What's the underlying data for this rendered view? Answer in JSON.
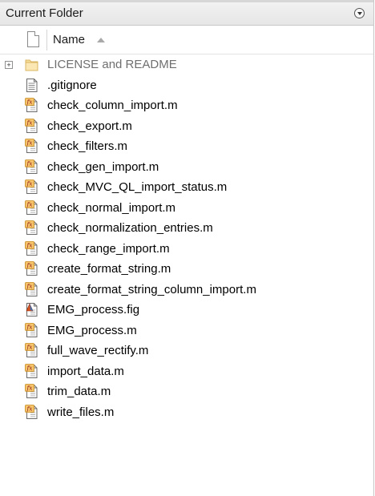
{
  "panel": {
    "title": "Current Folder",
    "menu_icon": "circle-chevron-down-icon",
    "column_header": "Name",
    "sort_indicator": "sort-ascending-icon"
  },
  "files": [
    {
      "name": "LICENSE and README",
      "type": "folder",
      "icon": "folder-icon"
    },
    {
      "name": ".gitignore",
      "type": "text",
      "icon": "text-file-icon"
    },
    {
      "name": "check_column_import.m",
      "type": "function",
      "icon": "matlab-function-icon"
    },
    {
      "name": "check_export.m",
      "type": "function",
      "icon": "matlab-function-icon"
    },
    {
      "name": "check_filters.m",
      "type": "function",
      "icon": "matlab-function-icon"
    },
    {
      "name": "check_gen_import.m",
      "type": "function",
      "icon": "matlab-function-icon"
    },
    {
      "name": "check_MVC_QL_import_status.m",
      "type": "function",
      "icon": "matlab-function-icon"
    },
    {
      "name": "check_normal_import.m",
      "type": "function",
      "icon": "matlab-function-icon"
    },
    {
      "name": "check_normalization_entries.m",
      "type": "function",
      "icon": "matlab-function-icon"
    },
    {
      "name": "check_range_import.m",
      "type": "function",
      "icon": "matlab-function-icon"
    },
    {
      "name": "create_format_string.m",
      "type": "function",
      "icon": "matlab-function-icon"
    },
    {
      "name": "create_format_string_column_import.m",
      "type": "function",
      "icon": "matlab-function-icon"
    },
    {
      "name": "EMG_process.fig",
      "type": "figure",
      "icon": "matlab-figure-icon"
    },
    {
      "name": "EMG_process.m",
      "type": "function",
      "icon": "matlab-function-icon"
    },
    {
      "name": "full_wave_rectify.m",
      "type": "function",
      "icon": "matlab-function-icon"
    },
    {
      "name": "import_data.m",
      "type": "function",
      "icon": "matlab-function-icon"
    },
    {
      "name": "trim_data.m",
      "type": "function",
      "icon": "matlab-function-icon"
    },
    {
      "name": "write_files.m",
      "type": "function",
      "icon": "matlab-function-icon"
    }
  ]
}
